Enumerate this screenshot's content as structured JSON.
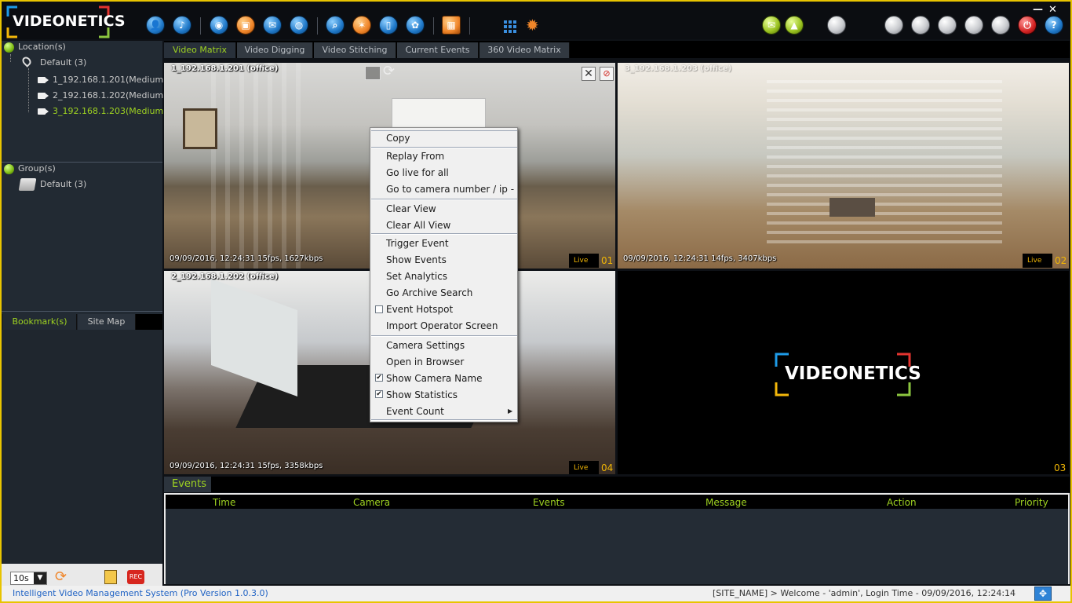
{
  "app": {
    "product_name": "Intelligent Video Management System (Pro Version 1.0.3.0)",
    "logo_text": "VIDEONETICS"
  },
  "colors": {
    "accent_green": "#9fd321",
    "frame_yellow": "#e8c400",
    "live_amber": "#f2b705"
  },
  "window": {
    "minimize": "—",
    "close": "✕"
  },
  "toolbar": {
    "icons": [
      "user-icon",
      "notes-icon",
      "search-camera-icon",
      "snapshot-icon",
      "message-icon",
      "globe-icon",
      "zoom-search-icon",
      "motion-icon",
      "mobile-icon",
      "film-reel-icon",
      "layout-screen-icon",
      "grid-icon",
      "gear-icon",
      "email-icon",
      "user-alert-icon",
      "status-light-icon",
      "status-light-icon",
      "status-light-icon",
      "status-light-icon",
      "status-light-icon",
      "status-light-icon",
      "power-icon",
      "help-icon"
    ],
    "help_glyph": "?"
  },
  "sidebar": {
    "location_header": "Location(s)",
    "location_root": "Default (3)",
    "cameras": [
      "1_192.168.1.201(Medium)",
      "2_192.168.1.202(Medium)",
      "3_192.168.1.203(Medium)"
    ],
    "group_header": "Group(s)",
    "group_root": "Default (3)",
    "tabs": [
      "Bookmark(s)",
      "Site Map"
    ],
    "interval": "10s",
    "rec_label": "REC"
  },
  "main_tabs": [
    "Video Matrix",
    "Video Digging",
    "Video Stitching",
    "Current Events",
    "360 Video Matrix"
  ],
  "cells": [
    {
      "title": "1_192.168.1.201 (office)",
      "stats": "09/09/2016, 12:24:31  15fps, 1627kbps",
      "live": "Live",
      "num": "01"
    },
    {
      "title": "3_192.168.1.203 (office)",
      "stats": "09/09/2016, 12:24:31  14fps, 3407kbps",
      "live": "Live",
      "num": "02"
    },
    {
      "title": "2_192.168.1.202 (office)",
      "stats": "09/09/2016, 12:24:31  15fps, 3358kbps",
      "live": "Live",
      "num": "04"
    },
    {
      "title": "",
      "stats": "",
      "live": "",
      "num": "03",
      "placeholder_logo": "VIDEONETICS"
    }
  ],
  "context_menu": {
    "items": [
      "Copy",
      "Replay From",
      "Go live for all",
      "Go to camera number / ip -",
      "Clear View",
      "Clear All View",
      "Trigger Event",
      "Show Events",
      "Set Analytics",
      "Go Archive Search",
      "Event Hotspot",
      "Import Operator Screen",
      "Camera Settings",
      "Open in Browser",
      "Show Camera Name",
      "Show Statistics",
      "Event Count"
    ],
    "checked": {
      "event_hotspot": false,
      "show_camera_name": true,
      "show_statistics": true
    },
    "submenu_arrow": "▶"
  },
  "events": {
    "tab": "Events",
    "columns": [
      "Time",
      "Camera",
      "Events",
      "Message",
      "Action",
      "Priority"
    ]
  },
  "status": {
    "text": "[SITE_NAME] > Welcome - 'admin',   Login Time - 09/09/2016, 12:24:14"
  }
}
